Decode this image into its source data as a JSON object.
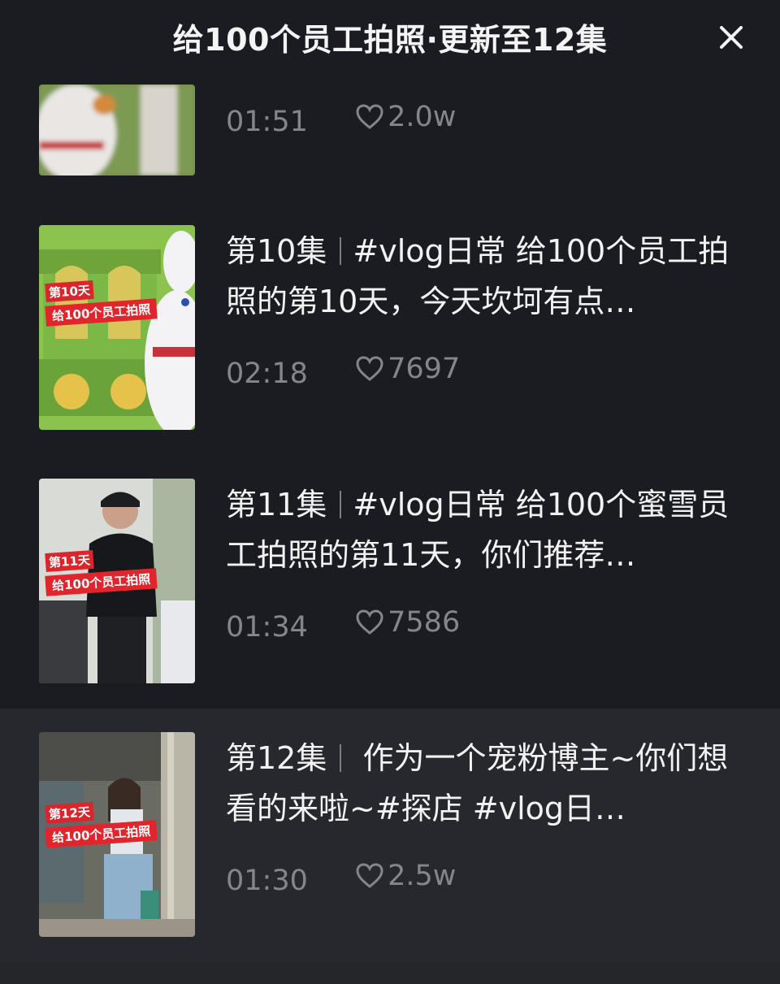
{
  "header": {
    "title": "给100个员工拍照·更新至12集"
  },
  "episodes": [
    {
      "duration": "01:51",
      "likes": "2.0w"
    },
    {
      "ep_label": "第10集",
      "title_text": "#vlog日常 给100个员工拍照的第10天，今天坎坷有点…",
      "duration": "02:18",
      "likes": "7697",
      "badge_day": "第10天",
      "badge_sub": "给100个员工拍照"
    },
    {
      "ep_label": "第11集",
      "title_text": "#vlog日常 给100个蜜雪员工拍照的第11天，你们推荐…",
      "duration": "01:34",
      "likes": "7586",
      "badge_day": "第11天",
      "badge_sub": "给100个员工拍照"
    },
    {
      "ep_label": "第12集",
      "title_text": " 作为一个宠粉博主~你们想看的来啦~#探店 #vlog日…",
      "duration": "01:30",
      "likes": "2.5w",
      "badge_day": "第12天",
      "badge_sub": "给100个员工拍照",
      "active": true
    }
  ],
  "icons": {
    "close": "close-icon",
    "like": "heart-icon"
  },
  "colors": {
    "background": "#1b1c21",
    "active_row": "#27282d",
    "meta_text": "#85868b",
    "badge_red": "#d9262c"
  }
}
